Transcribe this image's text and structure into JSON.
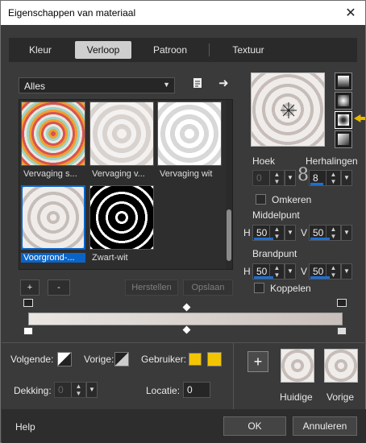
{
  "window": {
    "title": "Eigenschappen van materiaal",
    "close_glyph": "✕"
  },
  "tabs": [
    {
      "label": "Kleur"
    },
    {
      "label": "Verloop"
    },
    {
      "label": "Patroon"
    },
    {
      "label": "Textuur"
    }
  ],
  "category": {
    "value": "Alles"
  },
  "gallery": {
    "items": [
      {
        "label": "Vervaging s..."
      },
      {
        "label": "Vervaging v..."
      },
      {
        "label": "Vervaging wit"
      },
      {
        "label": "Voorgrond-..."
      },
      {
        "label": "Zwart-wit"
      }
    ]
  },
  "gallery_buttons": {
    "add": "+",
    "remove": "-",
    "restore": "Herstellen",
    "save": "Opslaan"
  },
  "angle": {
    "label": "Hoek",
    "value": "0"
  },
  "repeats": {
    "label": "Herhalingen",
    "value": "8"
  },
  "invert": {
    "label": "Omkeren"
  },
  "center": {
    "label": "Middelpunt",
    "h_label": "H",
    "h_value": "50",
    "v_label": "V",
    "v_value": "50"
  },
  "focal": {
    "label": "Brandpunt",
    "h_label": "H",
    "h_value": "50",
    "v_label": "V",
    "v_value": "50"
  },
  "link": {
    "label": "Koppelen"
  },
  "bottom": {
    "next_label": "Volgende:",
    "prev_label": "Vorige:",
    "user_label": "Gebruiker:",
    "opacity_label": "Dekking:",
    "opacity_value": "0",
    "location_label": "Locatie:",
    "location_value": "0",
    "current_label": "Huidige",
    "previous_label": "Vorige",
    "user_color": "#f2c500"
  },
  "footer": {
    "help": "Help",
    "ok": "OK",
    "cancel": "Annuleren"
  },
  "colors": {
    "accent": "#1e6fd0",
    "indicator": "#e8b800"
  }
}
